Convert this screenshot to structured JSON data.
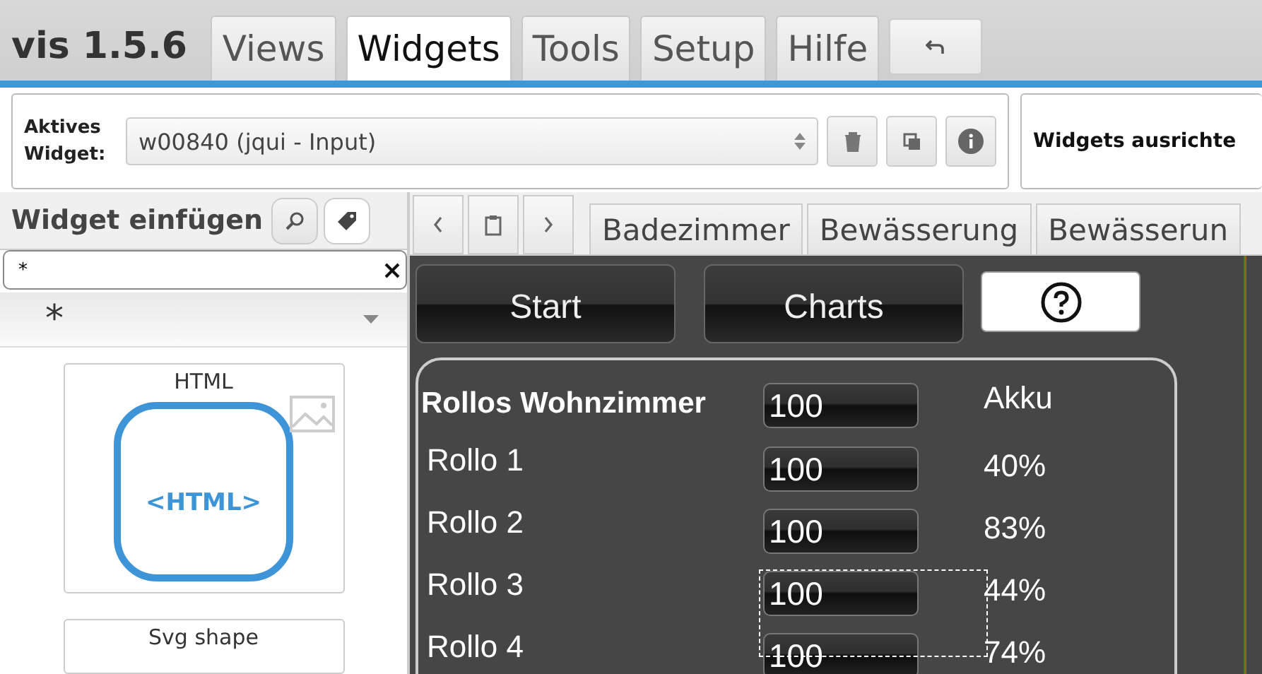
{
  "app": {
    "title": "vis 1.5.6"
  },
  "menu_tabs": [
    {
      "label": "Views",
      "selected": false
    },
    {
      "label": "Widgets",
      "selected": true
    },
    {
      "label": "Tools",
      "selected": false
    },
    {
      "label": "Setup",
      "selected": false
    },
    {
      "label": "Hilfe",
      "selected": false
    }
  ],
  "active_widget": {
    "label": "Aktives Widget:",
    "value": "w00840 (jqui - Input)"
  },
  "align_panel": {
    "title": "Widgets ausrichte"
  },
  "palette": {
    "title": "Widget einfügen",
    "tools": [
      {
        "kind": "search",
        "selected": false
      },
      {
        "kind": "tag",
        "selected": true
      }
    ],
    "search": {
      "value": "*"
    },
    "set_filter": {
      "value": "*"
    },
    "widgets": [
      {
        "label": "HTML",
        "kind": "html",
        "preview_text": "<HTML>"
      },
      {
        "label": "Svg shape",
        "kind": "plain"
      }
    ]
  },
  "view_tabs": [
    {
      "label": "Badezimmer",
      "selected": false
    },
    {
      "label": "Bewässerung",
      "selected": false
    },
    {
      "label": "Bewässerun",
      "selected": false
    }
  ],
  "canvas": {
    "buttons": [
      {
        "label": "Start",
        "kind": "nav"
      },
      {
        "label": "Charts",
        "kind": "nav"
      },
      {
        "kind": "help"
      }
    ],
    "panel": {
      "title": "Rollos Wohnzimmer",
      "title_value": "100",
      "column_header": "Akku",
      "rows": [
        {
          "name": "Rollo 1",
          "value": "100",
          "akku": "40%",
          "selected": false
        },
        {
          "name": "Rollo 2",
          "value": "100",
          "akku": "83%",
          "selected": false
        },
        {
          "name": "Rollo 3",
          "value": "100",
          "akku": "44%",
          "selected": true
        },
        {
          "name": "Rollo 4",
          "value": "100",
          "akku": "74%",
          "selected": false
        }
      ]
    }
  }
}
